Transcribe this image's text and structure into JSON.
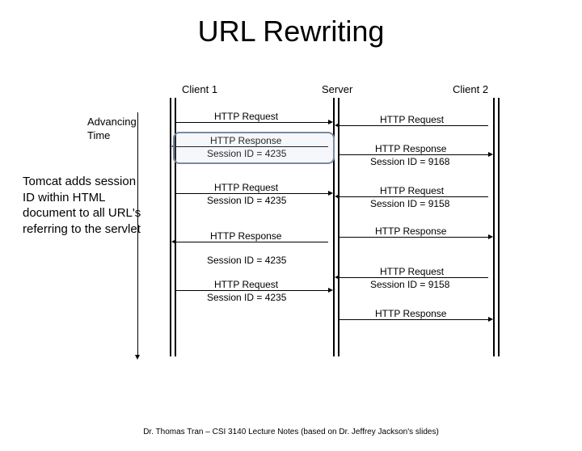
{
  "title": "URL Rewriting",
  "lanes": {
    "client1": "Client 1",
    "server": "Server",
    "client2": "Client 2"
  },
  "time_label_l1": "Advancing",
  "time_label_l2": "Time",
  "annotation": "Tomcat adds session ID within HTML document to all URL's referring to the servlet",
  "labels": {
    "http_request": "HTTP Request",
    "http_response": "HTTP Response",
    "sid_4235": "Session ID = 4235",
    "sid_9168_a": "Session ID = 9168",
    "sid_9158_b": "Session ID = 9158",
    "sid_9158_c": "Session ID = 9158"
  },
  "footer": "Dr. Thomas Tran – CSI 3140 Lecture Notes (based on Dr. Jeffrey Jackson's slides)",
  "chart_data": {
    "type": "sequence",
    "participants": [
      "Client 1",
      "Server",
      "Client 2"
    ],
    "messages": [
      {
        "from": "Client 1",
        "to": "Server",
        "label": "HTTP Request"
      },
      {
        "from": "Client 2",
        "to": "Server",
        "label": "HTTP Request"
      },
      {
        "from": "Server",
        "to": "Client 1",
        "label": "HTTP Response",
        "note": "Session ID = 4235",
        "highlighted": true
      },
      {
        "from": "Server",
        "to": "Client 2",
        "label": "HTTP Response",
        "note": "Session ID = 9168"
      },
      {
        "from": "Client 1",
        "to": "Server",
        "label": "HTTP Request",
        "note": "Session ID = 4235"
      },
      {
        "from": "Client 2",
        "to": "Server",
        "label": "HTTP Request",
        "note": "Session ID = 9158"
      },
      {
        "from": "Server",
        "to": "Client 1",
        "label": "HTTP Response",
        "note": "Session ID = 4235"
      },
      {
        "from": "Server",
        "to": "Client 2",
        "label": "HTTP Response"
      },
      {
        "from": "Client 1",
        "to": "Server",
        "label": "HTTP Request",
        "note": "Session ID = 4235"
      },
      {
        "from": "Client 2",
        "to": "Server",
        "label": "HTTP Request",
        "note": "Session ID = 9158"
      },
      {
        "from": "Server",
        "to": "Client 2",
        "label": "HTTP Response"
      }
    ]
  }
}
